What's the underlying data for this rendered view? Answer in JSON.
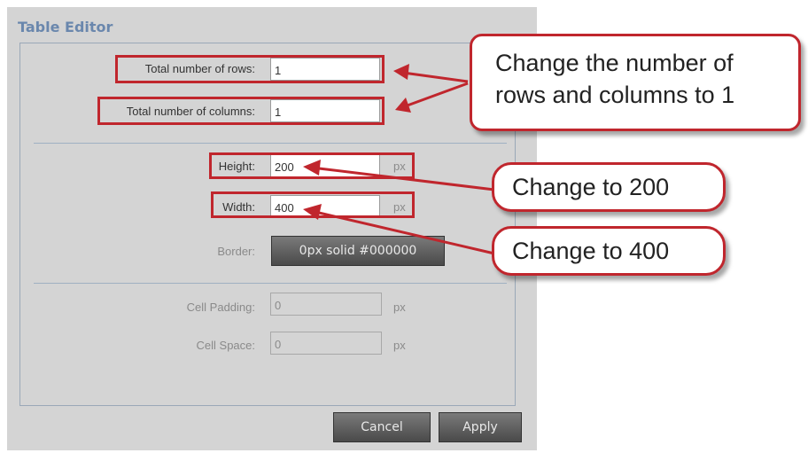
{
  "dialog": {
    "title": "Table Editor",
    "rows": {
      "label": "Total number of rows:",
      "value": "1"
    },
    "columns": {
      "label": "Total number of columns:",
      "value": "1"
    },
    "height": {
      "label": "Height:",
      "value": "200",
      "unit": "px"
    },
    "width": {
      "label": "Width:",
      "value": "400",
      "unit": "px"
    },
    "border": {
      "label": "Border:",
      "value": "0px solid #000000"
    },
    "cell_padding": {
      "label": "Cell Padding:",
      "value": "0",
      "unit": "px"
    },
    "cell_space": {
      "label": "Cell Space:",
      "value": "0",
      "unit": "px"
    },
    "buttons": {
      "cancel": "Cancel",
      "apply": "Apply"
    }
  },
  "callouts": {
    "rows_columns": [
      "Change the number of",
      "rows and columns to 1"
    ],
    "height": "Change to 200",
    "width": "Change to 400"
  },
  "colors": {
    "highlight": "#c0262d",
    "title": "#6a87ad",
    "dialog_bg": "#d4d4d4"
  }
}
